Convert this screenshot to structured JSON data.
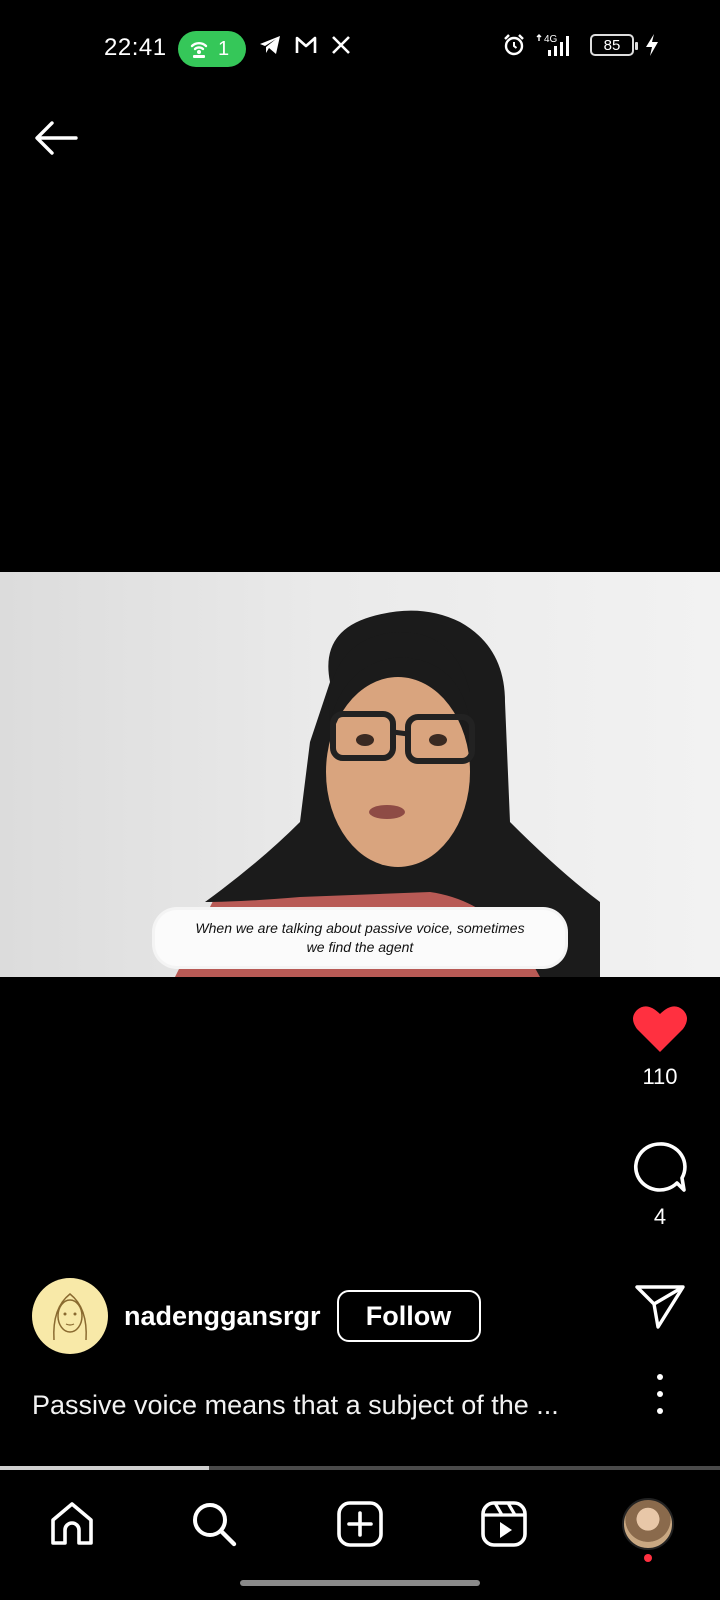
{
  "status_bar": {
    "time": "22:41",
    "hotspot_count": "1",
    "network": "4G",
    "battery": "85",
    "left_icons": [
      "telegram-icon",
      "gmail-icon",
      "x-icon"
    ],
    "right_icons": [
      "alarm-icon",
      "signal-icon",
      "battery-icon",
      "charging-icon"
    ]
  },
  "video": {
    "subtitle_line1": "When we are talking about passive voice, sometimes",
    "subtitle_line2": "we find the agent",
    "progress_fraction": 0.29
  },
  "actions": {
    "like_count": "110",
    "comment_count": "4",
    "like_color": "#ff3040"
  },
  "author": {
    "username": "nadenggansrgr",
    "follow_label": "Follow"
  },
  "caption": "Passive voice means that a subject of the ...",
  "nav": [
    "home-icon",
    "search-icon",
    "create-icon",
    "reels-icon",
    "profile-avatar"
  ],
  "colors": {
    "background": "#000000",
    "hotspot": "#35c759",
    "notification_dot": "#ff3040"
  }
}
